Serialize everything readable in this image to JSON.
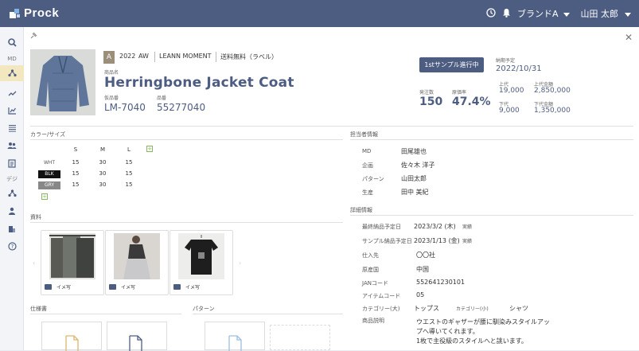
{
  "app": {
    "name": "Prock"
  },
  "topbar": {
    "brand": "ブランドA",
    "user": "山田 太郎"
  },
  "sidebar": {
    "md_label": "MD",
    "design_label": "デジ"
  },
  "product": {
    "badge": "A",
    "year": "2022",
    "season": "AW",
    "brand": "LEANN MOMENT",
    "label": "送料無料（ラベル）",
    "name_label": "商品名",
    "name": "Herringbone Jacket Coat",
    "temp_no_label": "仮品番",
    "temp_no": "LM-7040",
    "no_label": "品番",
    "no": "55277040"
  },
  "status": {
    "button": "1stサンプル進行中",
    "due_label": "納期予定",
    "due": "2022/10/31",
    "order_label": "発注数",
    "order": "150",
    "cost_rate_label": "原価率",
    "cost_rate": "47.4%",
    "retail_label": "上代",
    "retail": "19,000",
    "retail_total_label": "上代金額",
    "retail_total": "2,850,000",
    "wholesale_label": "下代",
    "wholesale": "9,000",
    "wholesale_total_label": "下代金額",
    "wholesale_total": "1,350,000"
  },
  "color_size": {
    "title": "カラー/サイズ",
    "sizes": [
      "S",
      "M",
      "L"
    ],
    "rows": [
      {
        "color": "WHT",
        "values": [
          "15",
          "30",
          "15"
        ],
        "bg": "#ffffff",
        "fg": "#555555"
      },
      {
        "color": "BLK",
        "values": [
          "15",
          "30",
          "15"
        ],
        "bg": "#111111",
        "fg": "#ffffff"
      },
      {
        "color": "GRY",
        "values": [
          "15",
          "30",
          "15"
        ],
        "bg": "#888888",
        "fg": "#ffffff"
      }
    ]
  },
  "materials": {
    "title": "資料",
    "cards": [
      {
        "label": "イメ写"
      },
      {
        "label": "イメ写"
      },
      {
        "label": "イメ写"
      }
    ]
  },
  "spec_title": "仕様書",
  "pattern_title": "パターン",
  "staff": {
    "title": "担当者情報",
    "rows": [
      {
        "key": "MD",
        "value": "田尾雄也"
      },
      {
        "key": "企画",
        "value": "佐々木 洋子"
      },
      {
        "key": "パターン",
        "value": "山田太郎"
      },
      {
        "key": "生産",
        "value": "田中 美紀"
      }
    ]
  },
  "details": {
    "title": "詳細情報",
    "rows": [
      {
        "key": "最終納品予定日",
        "value": "2023/3/2 (木)",
        "note": "実績"
      },
      {
        "key": "サンプル納品予定日",
        "value": "2023/1/13 (金)",
        "note": "実績"
      },
      {
        "key": "仕入先",
        "value": "〇〇社",
        "note": ""
      },
      {
        "key": "原産国",
        "value": "中国",
        "note": ""
      },
      {
        "key": "JANコード",
        "value": "552641230101",
        "note": ""
      },
      {
        "key": "アイテムコード",
        "value": "05",
        "note": ""
      }
    ],
    "category_large_label": "カテゴリー(大)",
    "category_large": "トップス",
    "category_small_label": "カテゴリー(小)",
    "category_small": "シャツ",
    "description_label": "商品説明",
    "description": [
      "ウエストのギャザーが腰に馴染みスタイルアッ",
      "プへ導いてくれます。",
      "1枚で主役級のスタイルへと誂います。"
    ]
  }
}
